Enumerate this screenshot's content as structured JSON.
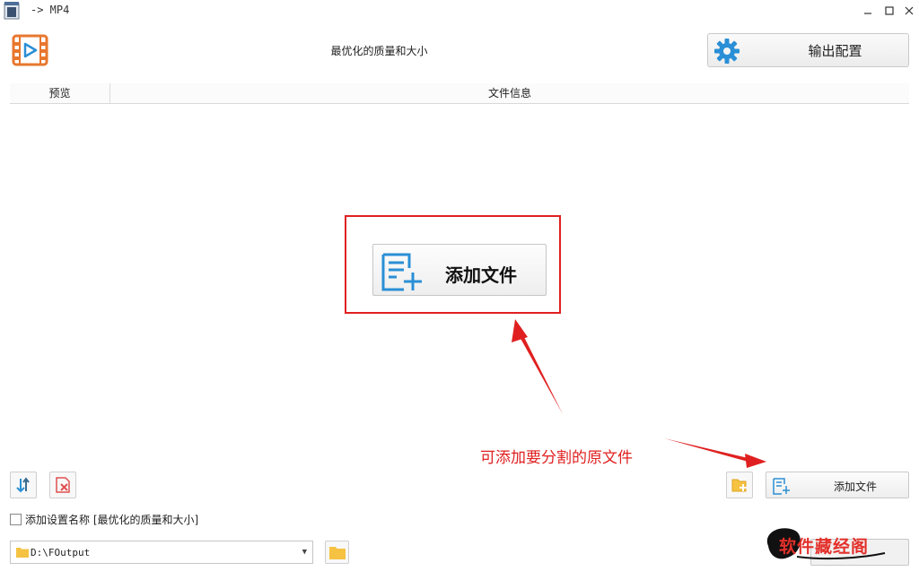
{
  "window": {
    "title": "-> MP4",
    "controls": [
      "minimize",
      "maximize",
      "close"
    ]
  },
  "header": {
    "preset_title": "最优化的质量和大小",
    "output_button_label": "输出配置"
  },
  "list": {
    "columns": [
      "预览",
      "文件信息"
    ]
  },
  "center": {
    "add_files_label": "添加文件"
  },
  "annotation": {
    "text": "可添加要分割的原文件",
    "color": "#e02020"
  },
  "toolbar": {
    "add_files_label": "添加文件"
  },
  "options": {
    "append_setting_name_label": "添加设置名称 [最优化的质量和大小]",
    "append_setting_name_checked": false
  },
  "output": {
    "path": "D:\\FOutput"
  },
  "watermark": {
    "text": "软件藏经阁"
  },
  "colors": {
    "accent_blue": "#2a8fd6",
    "logo_orange": "#e8772e",
    "highlight_red": "#e02020",
    "folder_yellow": "#f5c242"
  },
  "icons": {
    "logo": "film-play-icon",
    "output_config": "gear-icon",
    "add_file": "add-file-icon",
    "sort": "sort-icon",
    "clear": "delete-file-icon",
    "add_folder": "add-folder-icon",
    "browse": "folder-icon"
  }
}
